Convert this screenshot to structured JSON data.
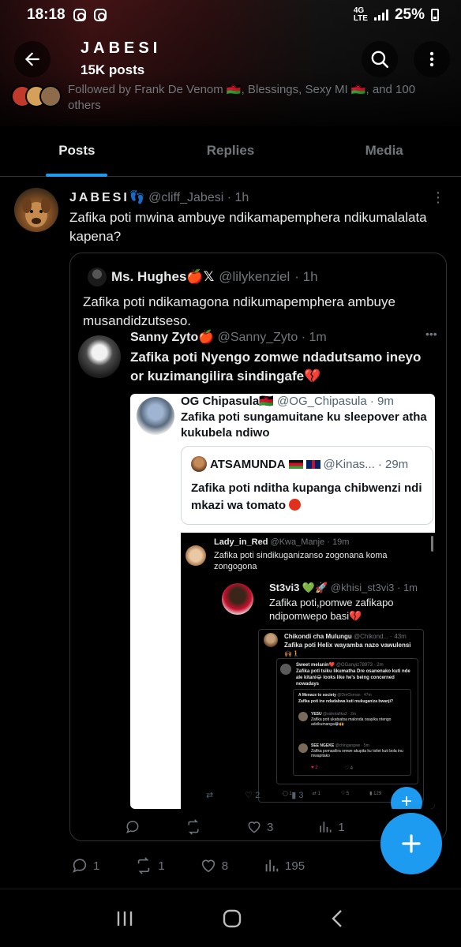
{
  "status_bar": {
    "time": "18:18",
    "network": "4G LTE",
    "battery": "25%"
  },
  "profile": {
    "name": "JABESI",
    "post_count": "15K posts",
    "followed_by": "Followed by Frank De Venom 🇲🇼, Blessings, Sexy MI 🇲🇼, and 100 others"
  },
  "tabs": [
    {
      "label": "Posts",
      "active": true
    },
    {
      "label": "Replies",
      "active": false
    },
    {
      "label": "Media",
      "active": false
    }
  ],
  "post": {
    "author": "JABESI",
    "handle": "@cliff_Jabesi",
    "time": "· 1h",
    "text": "Zafika poti mwina ambuye ndikamapemphera ndikumalalata kapena?",
    "actions": {
      "replies": "1",
      "reposts": "1",
      "likes": "8",
      "views": "195"
    }
  },
  "quote": {
    "author": "Ms. Hughes🍎𝕏",
    "handle": "@lilykenziel",
    "time": "· 1h",
    "text": "Zafika poti ndikamagona ndikumapemphera ambuye musandidzutseso.",
    "actions": {
      "replies": "",
      "reposts": "",
      "likes": "3",
      "views": "1"
    }
  },
  "nested": {
    "sanny": {
      "author": "Sanny Zyto🍎",
      "handle": "@Sanny_Zyto",
      "time": "· 1m",
      "text": "Zafika poti Nyengo zomwe ndadutsamo ineyo or kuzimangilira sindingafe💔"
    },
    "og": {
      "author": "OG Chipasula🇲🇼",
      "handle": "@OG_Chipasula",
      "time": "· 9m",
      "text": "Zafika poti sungamuitane ku sleepover  atha kukubela ndiwo"
    },
    "atsamunda": {
      "author": "ATSAMUNDA",
      "handle": "@Kinas...",
      "time": "· 29m",
      "text": "Zafika poti nditha kupanga chibwenzi ndi mkazi wa tomato"
    },
    "lady": {
      "author": "Lady_in_Red",
      "handle": "@Kwa_Manje",
      "time": "· 19m",
      "text": "Zafika poti sindikuganizanso zogonana koma zongogona"
    },
    "st3vi3": {
      "author": "St3vi3 💚🚀",
      "handle": "@khisi_st3vi3",
      "time": "· 1m",
      "text": "Zafika poti,pomwe zafikapo ndipomwepo basi"
    },
    "chikondi": {
      "author": "Chikondi cha Mulungu",
      "handle": "@Chikond...",
      "time": "· 43m",
      "text": "Zafika poti Helix wayamba nazo vawulensi 🙌🏾🚶"
    },
    "sweet": {
      "author": "Sweet melanin❤️",
      "handle": "@OGanyiz78973",
      "time": "· 2m",
      "text": "Zafika poti tsiku likumatha Dre osanenako kuti nde ale kitani😂 looks like he's being concerned nowadays"
    },
    "menace": {
      "author": "A Menace to society",
      "handle": "@DreOsman",
      "time": "· 47m",
      "text": "Zafika poti ine ndadabwa kuti mukuganiza bwanji?"
    },
    "yesu": {
      "author": "YESU",
      "handle": "@sidrotafika2",
      "time": "· 2m",
      "text": "Zafika poti ukatsatsa malonda osayika ntengo adzikumanga😂🙌"
    },
    "seengeke": {
      "author": "SEE NGEKE",
      "handle": "@chingangwe",
      "time": "· 5m",
      "text": "Zafika pomasilira omwe akupita ku toilet kuti bola inu mwapitako"
    },
    "mini_counts": [
      "1",
      "1",
      "5",
      "129"
    ],
    "tiny_counts": [
      "2",
      "4"
    ],
    "og_counts": [
      "2",
      "3"
    ]
  },
  "icons": {
    "back": "arrow-left-icon",
    "search": "search-icon",
    "more": "more-vertical-icon",
    "reply": "reply-icon",
    "repost": "repost-icon",
    "like": "heart-icon",
    "views": "analytics-icon",
    "compose": "plus-icon"
  },
  "colors": {
    "accent": "#1d9bf0",
    "background": "#000000",
    "text": "#e7e9ea",
    "muted": "#71767b"
  }
}
